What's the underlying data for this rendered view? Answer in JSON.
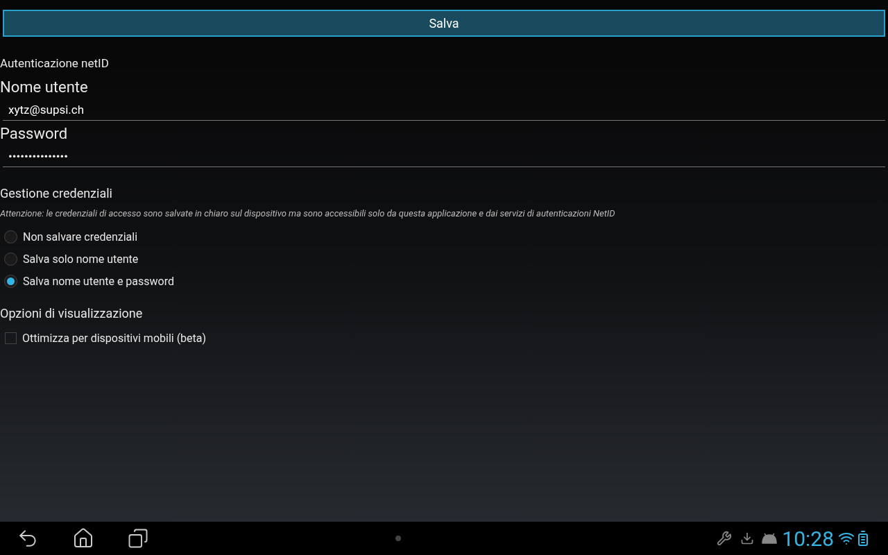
{
  "save_button": {
    "label": "Salva"
  },
  "auth": {
    "title": "Autenticazione netID",
    "fields": [
      {
        "label": "Nome utente",
        "value": "xytz@supsi.ch"
      },
      {
        "label": "Password",
        "value": "•••••••••••••••"
      }
    ]
  },
  "credentials": {
    "title": "Gestione credenziali",
    "note": "Attenzione: le credenziali di accesso sono salvate in chiaro sul dispositivo ma sono accessibili solo da questa applicazione e dai servizi di autenticazioni NetID",
    "options": [
      {
        "label": "Non salvare credenziali",
        "selected": false
      },
      {
        "label": "Salva solo nome utente",
        "selected": false
      },
      {
        "label": "Salva nome utente e password",
        "selected": true
      }
    ]
  },
  "display": {
    "title": "Opzioni di visualizzazione",
    "options": [
      {
        "label": "Ottimizza per dispositivi mobili (beta)",
        "checked": false
      }
    ]
  },
  "status_bar": {
    "time": "10:28"
  }
}
